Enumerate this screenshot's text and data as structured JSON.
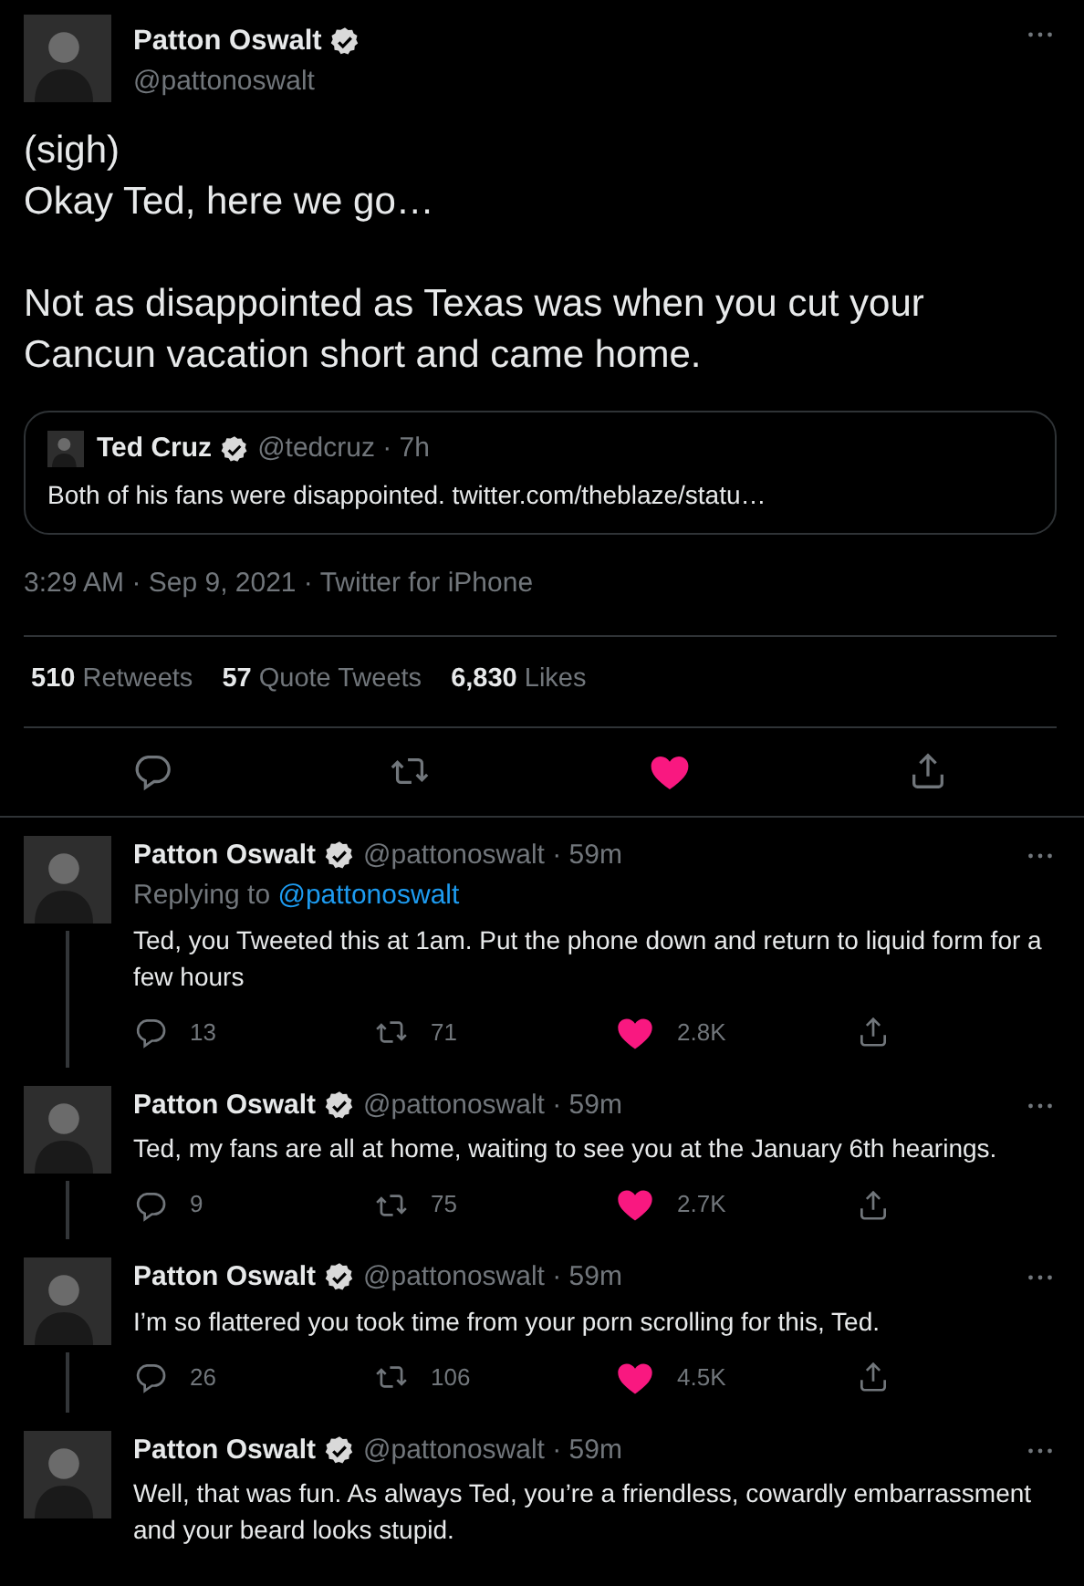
{
  "main_tweet": {
    "name": "Patton Oswalt",
    "verified": true,
    "handle": "@pattonoswalt",
    "text": "(sigh)\nOkay Ted, here we go…\n\nNot as disappointed as Texas was when you cut your Cancun vacation short and came home.",
    "quote": {
      "name": "Ted Cruz",
      "verified": true,
      "handle": "@tedcruz",
      "time": "· 7h",
      "text": "Both of his fans were disappointed. twitter.com/theblaze/statu…"
    },
    "meta": "3:29 AM · Sep 9, 2021 · Twitter for iPhone",
    "stats": [
      {
        "count": "510",
        "label": "Retweets"
      },
      {
        "count": "57",
        "label": "Quote Tweets"
      },
      {
        "count": "6,830",
        "label": "Likes"
      }
    ],
    "liked": true
  },
  "replies": [
    {
      "name": "Patton Oswalt",
      "verified": true,
      "handle": "@pattonoswalt",
      "time": "· 59m",
      "replying_prefix": "Replying to",
      "replying_handle": "@pattonoswalt",
      "text": "Ted, you Tweeted this at 1am. Put the phone down and return to liquid form for a few hours",
      "counts": {
        "replies": "13",
        "retweets": "71",
        "likes": "2.8K"
      },
      "liked": true,
      "thread_line": true
    },
    {
      "name": "Patton Oswalt",
      "verified": true,
      "handle": "@pattonoswalt",
      "time": "· 59m",
      "text": "Ted, my fans are all at home, waiting to see you at the January 6th hearings.",
      "counts": {
        "replies": "9",
        "retweets": "75",
        "likes": "2.7K"
      },
      "liked": true,
      "thread_line": true
    },
    {
      "name": "Patton Oswalt",
      "verified": true,
      "handle": "@pattonoswalt",
      "time": "· 59m",
      "text": "I’m so flattered you took time from your porn scrolling for this, Ted.",
      "counts": {
        "replies": "26",
        "retweets": "106",
        "likes": "4.5K"
      },
      "liked": true,
      "thread_line": true
    },
    {
      "name": "Patton Oswalt",
      "verified": true,
      "handle": "@pattonoswalt",
      "time": "· 59m",
      "text": "Well, that was fun. As always Ted, you’re a friendless, cowardly embarrassment and your beard looks stupid."
    }
  ]
}
